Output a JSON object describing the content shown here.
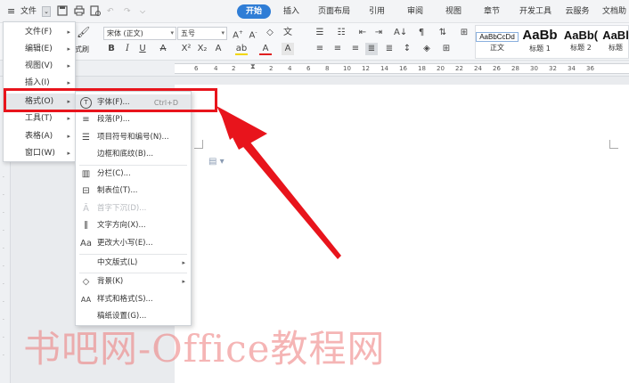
{
  "titlebar": {
    "menu_icon": "hamburger-icon",
    "file_label": "文件",
    "tabs": [
      {
        "label": "开始",
        "active": true
      },
      {
        "label": "插入",
        "active": false
      },
      {
        "label": "页面布局",
        "active": false
      },
      {
        "label": "引用",
        "active": false
      },
      {
        "label": "审阅",
        "active": false
      },
      {
        "label": "视图",
        "active": false
      },
      {
        "label": "章节",
        "active": false
      },
      {
        "label": "开发工具",
        "active": false
      },
      {
        "label": "云服务",
        "active": false
      },
      {
        "label": "文档助",
        "active": false
      }
    ]
  },
  "ribbon": {
    "format_painter": "式刷",
    "font_name": "宋体 (正文)",
    "font_size": "五号",
    "styles": [
      {
        "sample": "AaBbCcDd",
        "name": "正文"
      },
      {
        "sample": "AaBb",
        "name": "标题 1"
      },
      {
        "sample": "AaBb(",
        "name": "标题 2"
      },
      {
        "sample": "AaBl",
        "name": "标题"
      }
    ]
  },
  "ruler": {
    "ticks": [
      "6",
      "4",
      "2",
      "2",
      "4",
      "6",
      "8",
      "10",
      "12",
      "14",
      "16",
      "18",
      "20",
      "22",
      "24",
      "26",
      "28",
      "30",
      "32",
      "34",
      "36"
    ]
  },
  "menu_main": {
    "items": [
      {
        "label": "文件(F)",
        "has_submenu": true
      },
      {
        "label": "编辑(E)",
        "has_submenu": true
      },
      {
        "label": "视图(V)",
        "has_submenu": true
      },
      {
        "label": "插入(I)",
        "has_submenu": true
      },
      {
        "label": "格式(O)",
        "has_submenu": true,
        "active": true
      },
      {
        "label": "工具(T)",
        "has_submenu": true
      },
      {
        "label": "表格(A)",
        "has_submenu": true
      },
      {
        "label": "窗口(W)",
        "has_submenu": true
      }
    ]
  },
  "menu_format": {
    "items": [
      {
        "label": "字体(F)...",
        "shortcut": "Ctrl+D",
        "icon": "font-icon",
        "highlight": true
      },
      {
        "label": "段落(P)...",
        "icon": "paragraph-icon"
      },
      {
        "label": "项目符号和编号(N)...",
        "icon": "bullet-list-icon"
      },
      {
        "label": "边框和底纹(B)...",
        "icon": ""
      },
      {
        "label": "分栏(C)...",
        "icon": "columns-icon"
      },
      {
        "label": "制表位(T)...",
        "icon": "tab-stop-icon"
      },
      {
        "label": "首字下沉(D)...",
        "icon": "drop-cap-icon",
        "disabled": true
      },
      {
        "label": "文字方向(X)...",
        "icon": "text-direction-icon"
      },
      {
        "label": "更改大小写(E)...",
        "icon": "change-case-icon"
      },
      {
        "label": "中文版式(L)",
        "icon": "",
        "has_submenu": true
      },
      {
        "label": "背景(K)",
        "icon": "background-icon",
        "has_submenu": true
      },
      {
        "label": "样式和格式(S)...",
        "icon": "styles-icon"
      },
      {
        "label": "稿纸设置(G)...",
        "icon": ""
      }
    ]
  },
  "watermark": "书吧网-Office教程网",
  "colors": {
    "accent": "#2f7dd6",
    "highlight_box": "#e8141c",
    "arrow": "#e8141c"
  }
}
